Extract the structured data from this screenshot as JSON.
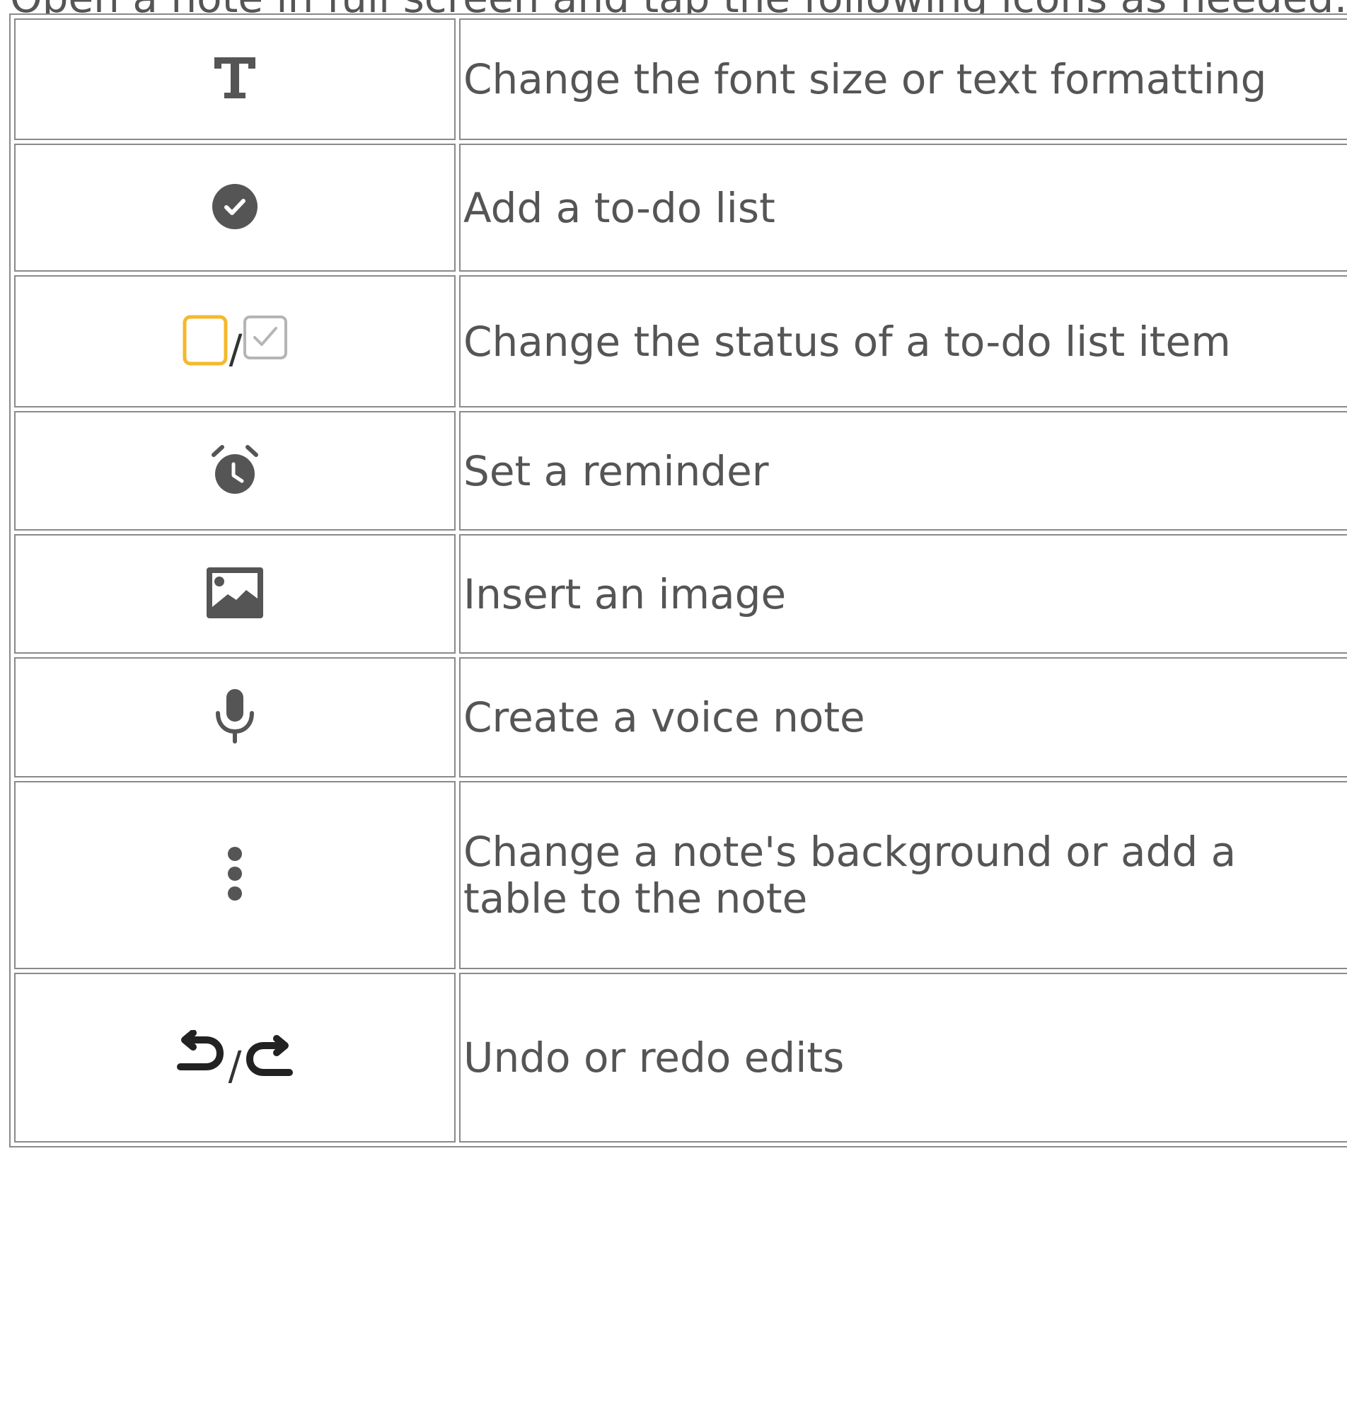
{
  "intro": "Open a note in full screen and tap the following icons as needed:",
  "rows": [
    {
      "icon": "text-format-icon",
      "description": "Change the font size or text formatting"
    },
    {
      "icon": "checkmark-circle-icon",
      "description": "Add a to-do list"
    },
    {
      "icon": "checkbox-status-icon",
      "separator": "/",
      "description": "Change the status of a to-do list item"
    },
    {
      "icon": "alarm-clock-icon",
      "description": "Set a reminder"
    },
    {
      "icon": "image-icon",
      "description": "Insert an image"
    },
    {
      "icon": "microphone-icon",
      "description": "Create a voice note"
    },
    {
      "icon": "more-options-icon",
      "description": "Change a note's background or add a table to the note"
    },
    {
      "icon": "undo-redo-icon",
      "separator": "/",
      "description": "Undo or redo edits"
    }
  ],
  "colors": {
    "icon_gray": "#555555",
    "checkbox_yellow": "#f5b82e",
    "checkbox_gray": "#b5b5b5",
    "border": "#8a8a8a",
    "text": "#555555"
  }
}
